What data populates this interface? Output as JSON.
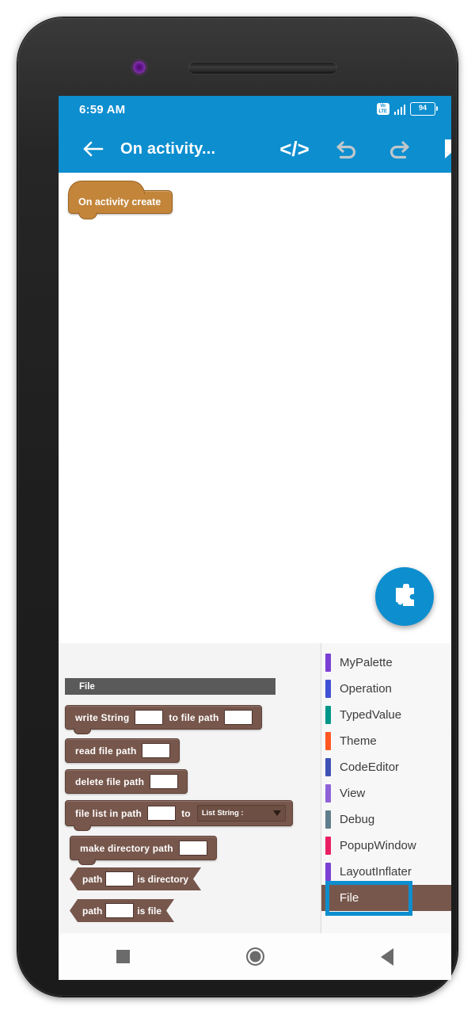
{
  "status_bar": {
    "time": "6:59 AM",
    "network_badge": "VoLTE",
    "signal_icon": "signal-bars-icon",
    "battery_level": "94"
  },
  "app_bar": {
    "back_icon": "back-arrow-icon",
    "title": "On activity...",
    "code_icon": "</>",
    "undo_icon": "undo-arrow-icon",
    "redo_icon": "redo-arrow-icon",
    "bookmark_icon": "bookmark-icon"
  },
  "workspace": {
    "hat_block_label": "On activity create",
    "fab_icon": "puzzle-piece-icon"
  },
  "flyout": {
    "header": "File",
    "blocks": [
      {
        "name": "write-string-to-file-path-block",
        "shape": "statement",
        "parts": [
          {
            "type": "text",
            "text": "write String"
          },
          {
            "type": "field",
            "value": ""
          },
          {
            "type": "text",
            "text": "to file path"
          },
          {
            "type": "field",
            "value": ""
          }
        ]
      },
      {
        "name": "read-file-path-block",
        "shape": "statement",
        "parts": [
          {
            "type": "text",
            "text": "read file path"
          },
          {
            "type": "field",
            "value": ""
          }
        ]
      },
      {
        "name": "delete-file-path-block",
        "shape": "statement",
        "parts": [
          {
            "type": "text",
            "text": "delete file path"
          },
          {
            "type": "field",
            "value": ""
          }
        ]
      },
      {
        "name": "file-list-in-path-block",
        "shape": "statement",
        "parts": [
          {
            "type": "text",
            "text": "file list in path"
          },
          {
            "type": "field",
            "value": ""
          },
          {
            "type": "text",
            "text": "to"
          },
          {
            "type": "dropdown",
            "value": "List String :"
          }
        ]
      },
      {
        "name": "make-directory-path-block",
        "shape": "statement",
        "parts": [
          {
            "type": "text",
            "text": "make directory path"
          },
          {
            "type": "field",
            "value": ""
          }
        ]
      },
      {
        "name": "path-is-directory-block",
        "shape": "boolean",
        "parts": [
          {
            "type": "text",
            "text": "path"
          },
          {
            "type": "field",
            "value": ""
          },
          {
            "type": "text",
            "text": "is directory"
          }
        ]
      },
      {
        "name": "path-is-file-block",
        "shape": "boolean",
        "parts": [
          {
            "type": "text",
            "text": "path"
          },
          {
            "type": "field",
            "value": ""
          },
          {
            "type": "text",
            "text": "is file"
          }
        ]
      }
    ]
  },
  "palette": {
    "items": [
      {
        "label": "MyPalette",
        "color": "#7b3fd4",
        "selected": false
      },
      {
        "label": "Operation",
        "color": "#3f51d4",
        "selected": false
      },
      {
        "label": "TypedValue",
        "color": "#009688",
        "selected": false
      },
      {
        "label": "Theme",
        "color": "#ff5722",
        "selected": false
      },
      {
        "label": "CodeEditor",
        "color": "#3f51b5",
        "selected": false
      },
      {
        "label": "View",
        "color": "#8e63d8",
        "selected": false
      },
      {
        "label": "Debug",
        "color": "#607d8b",
        "selected": false
      },
      {
        "label": "PopupWindow",
        "color": "#e91e63",
        "selected": false
      },
      {
        "label": "LayoutInflater",
        "color": "#7b3fd4",
        "selected": false
      },
      {
        "label": "File",
        "color": "#77574c",
        "selected": true
      }
    ],
    "selection_highlight_color": "#0d8ecf"
  },
  "nav_bar": {
    "recents_icon": "square-recents-icon",
    "home_icon": "circle-home-icon",
    "back_icon": "triangle-back-icon"
  },
  "theme": {
    "accent": "#0d8ecf",
    "block_brown": "#77574c",
    "hat_orange": "#c3853a"
  }
}
